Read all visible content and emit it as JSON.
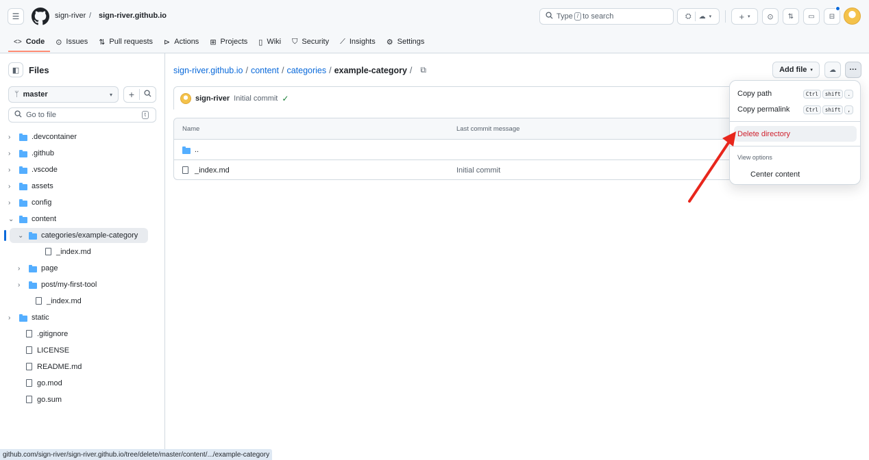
{
  "header": {
    "owner": "sign-river",
    "separator": "/",
    "repo": "sign-river.github.io",
    "search": {
      "pre": "Type",
      "key": "/",
      "post": "to search"
    }
  },
  "tabs": [
    {
      "label": "Code",
      "icon": "code-icon"
    },
    {
      "label": "Issues",
      "icon": "issue-icon"
    },
    {
      "label": "Pull requests",
      "icon": "pull-request-icon"
    },
    {
      "label": "Actions",
      "icon": "play-icon"
    },
    {
      "label": "Projects",
      "icon": "table-icon"
    },
    {
      "label": "Wiki",
      "icon": "book-icon"
    },
    {
      "label": "Security",
      "icon": "shield-icon"
    },
    {
      "label": "Insights",
      "icon": "graph-icon"
    },
    {
      "label": "Settings",
      "icon": "gear-icon"
    }
  ],
  "sidebar": {
    "title": "Files",
    "branch": "master",
    "goto_placeholder": "Go to file",
    "goto_key": "t",
    "tree": [
      {
        "label": ".devcontainer",
        "type": "folder",
        "depth": 0,
        "chev": "›"
      },
      {
        "label": ".github",
        "type": "folder",
        "depth": 0,
        "chev": "›"
      },
      {
        "label": ".vscode",
        "type": "folder",
        "depth": 0,
        "chev": "›"
      },
      {
        "label": "assets",
        "type": "folder",
        "depth": 0,
        "chev": "›"
      },
      {
        "label": "config",
        "type": "folder",
        "depth": 0,
        "chev": "›"
      },
      {
        "label": "content",
        "type": "folder",
        "depth": 0,
        "chev": "⌄"
      },
      {
        "label": "categories/example-category",
        "type": "folder",
        "depth": 1,
        "chev": "⌄",
        "selected": true
      },
      {
        "label": "_index.md",
        "type": "file",
        "depth": 2
      },
      {
        "label": "page",
        "type": "folder",
        "depth": 1,
        "chev": "›"
      },
      {
        "label": "post/my-first-tool",
        "type": "folder",
        "depth": 1,
        "chev": "›"
      },
      {
        "label": "_index.md",
        "type": "file",
        "depth": 1
      },
      {
        "label": "static",
        "type": "folder",
        "depth": 0,
        "chev": "›"
      },
      {
        "label": ".gitignore",
        "type": "file",
        "depth": 0
      },
      {
        "label": "LICENSE",
        "type": "file",
        "depth": 0
      },
      {
        "label": "README.md",
        "type": "file",
        "depth": 0
      },
      {
        "label": "go.mod",
        "type": "file",
        "depth": 0
      },
      {
        "label": "go.sum",
        "type": "file",
        "depth": 0
      }
    ]
  },
  "breadcrumb": {
    "repo": "sign-river.github.io",
    "p1": "content",
    "p2": "categories",
    "current": "example-category",
    "sep": "/"
  },
  "commit": {
    "author": "sign-river",
    "message": "Initial commit",
    "check": "✓"
  },
  "table": {
    "col_name": "Name",
    "col_msg": "Last commit message",
    "rows": [
      {
        "name": "..",
        "type": "folder",
        "msg": ""
      },
      {
        "name": "_index.md",
        "type": "file",
        "msg": "Initial commit"
      }
    ]
  },
  "toolbar": {
    "add_file": "Add file",
    "more": "···"
  },
  "menu": {
    "copy_path": "Copy path",
    "copy_path_keys": [
      "Ctrl",
      "shift",
      "."
    ],
    "copy_permalink": "Copy permalink",
    "copy_permalink_keys": [
      "Ctrl",
      "shift",
      ","
    ],
    "delete": "Delete directory",
    "view_options": "View options",
    "center": "Center content"
  },
  "status_url": "github.com/sign-river/sign-river.github.io/tree/delete/master/content/.../example-category",
  "colors": {
    "accent": "#0969da",
    "danger": "#cf222e",
    "arrow": "#e8261c"
  }
}
